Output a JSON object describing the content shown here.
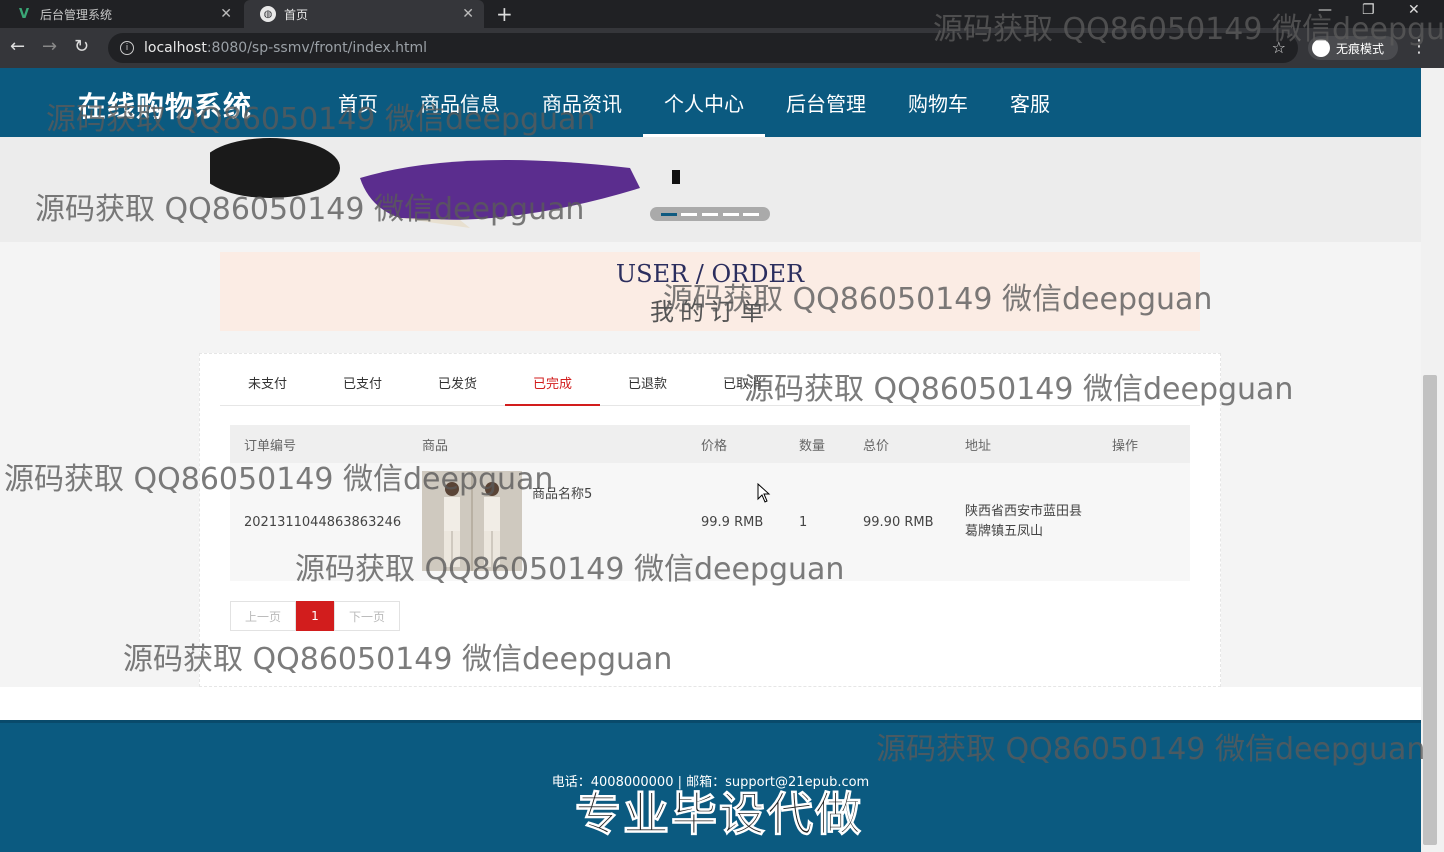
{
  "browser": {
    "tabs": [
      {
        "title": "后台管理系统",
        "icon": "vue-icon"
      },
      {
        "title": "首页",
        "icon": "globe-icon",
        "active": true
      }
    ],
    "url_host": "localhost",
    "url_path": ":8080/sp-ssmv/front/index.html",
    "incognito_label": "无痕模式"
  },
  "site": {
    "logo": "在线购物系统",
    "menu": [
      "首页",
      "商品信息",
      "商品资讯",
      "个人中心",
      "后台管理",
      "购物车",
      "客服"
    ],
    "active_menu": "个人中心"
  },
  "section": {
    "title_en": "USER / ORDER",
    "title_zh": "我的订单"
  },
  "order_tabs": [
    "未支付",
    "已支付",
    "已发货",
    "已完成",
    "已退款",
    "已取消"
  ],
  "active_order_tab": "已完成",
  "table": {
    "headers": [
      "订单编号",
      "商品",
      "价格",
      "数量",
      "总价",
      "地址",
      "操作"
    ],
    "rows": [
      {
        "order_no": "2021311044863863246",
        "product_name": "商品名称5",
        "price": "99.9 RMB",
        "quantity": "1",
        "total": "99.90 RMB",
        "address": "陕西省西安市蓝田县葛牌镇五凤山"
      }
    ]
  },
  "pager": {
    "prev": "上一页",
    "current": "1",
    "next": "下一页"
  },
  "footer": {
    "contact": "电话：4008000000 | 邮箱：support@21epub.com"
  },
  "watermark": {
    "text": "源码获取 QQ86050149 微信deepguan",
    "banner_text": "专业毕设代做"
  },
  "colors": {
    "header_bg": "#0b5a80",
    "accent_red": "#d21d1d",
    "title_bg": "#fbece4"
  }
}
